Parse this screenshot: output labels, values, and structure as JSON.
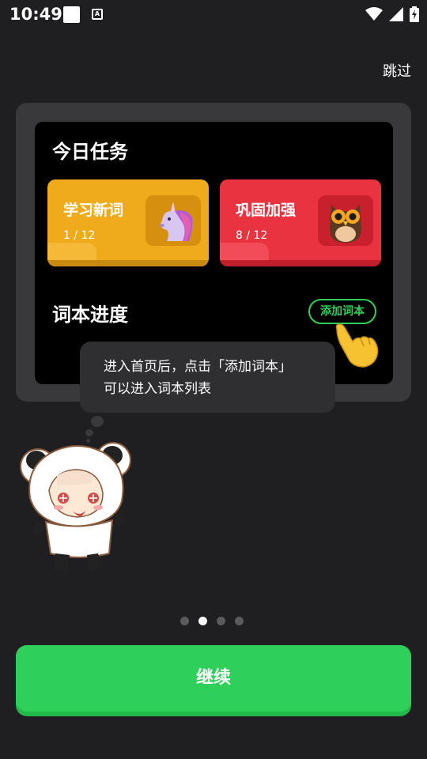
{
  "status_bar": {
    "time": "10:49",
    "icons": [
      "notification-square-icon",
      "keyboard-a-icon",
      "wifi-icon",
      "signal-icon",
      "battery-charging-icon"
    ]
  },
  "header": {
    "skip_label": "跳过"
  },
  "preview": {
    "today_title": "今日任务",
    "cards": [
      {
        "title": "学习新词",
        "count": "1 / 12",
        "icon": "unicorn-icon",
        "color": "#f0ab1d"
      },
      {
        "title": "巩固加强",
        "count": "8 / 12",
        "icon": "owl-icon",
        "color": "#ea3340"
      }
    ],
    "progress_title": "词本进度",
    "add_book_label": "添加词本"
  },
  "tooltip": {
    "line1": "进入首页后，点击「添加词本」",
    "line2": "可以进入词本列表"
  },
  "pager": {
    "total": 4,
    "active": 1
  },
  "footer": {
    "continue_label": "继续"
  },
  "colors": {
    "accent_green": "#2fd05a",
    "background": "#1f1e21",
    "card_yellow": "#f0ab1d",
    "card_red": "#ea3340"
  }
}
